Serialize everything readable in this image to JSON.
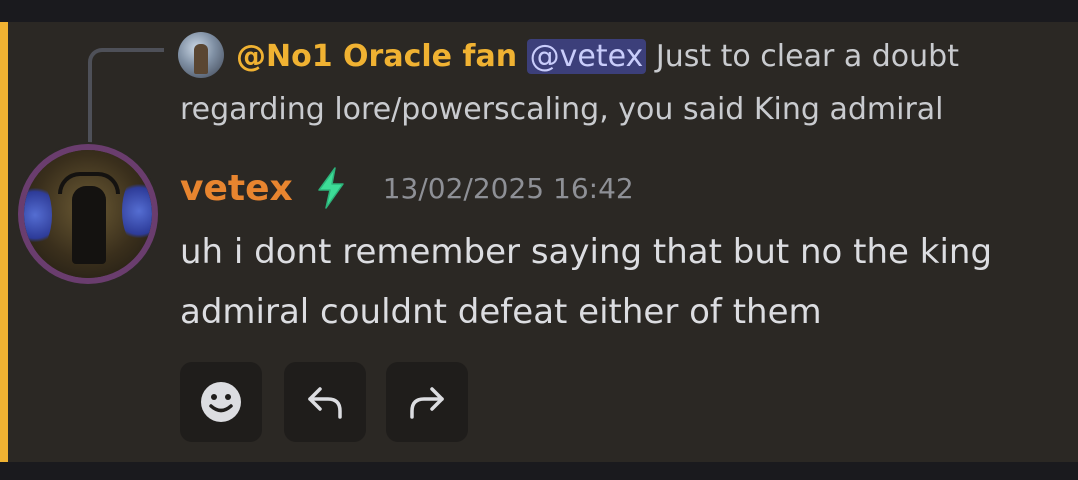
{
  "reply": {
    "author": "@No1 Oracle fan",
    "mention": "@vetex",
    "text_line1": " Just to clear a doubt",
    "text_line2": "regarding lore/powerscaling, you said King admiral"
  },
  "message": {
    "author": "vetex",
    "timestamp": "13/02/2025 16:42",
    "text": "uh i dont remember saying that but no the king admiral couldnt defeat either of them",
    "badge_icon": "lightning-bolt-icon"
  },
  "actions": [
    {
      "icon": "add-reaction-icon"
    },
    {
      "icon": "reply-icon"
    },
    {
      "icon": "forward-icon"
    }
  ],
  "colors": {
    "highlight": "#f0b232",
    "reply_author": "#f0b232",
    "author": "#e8852f",
    "badge": "#3ddc97",
    "mention_bg": "#3c3f7a"
  }
}
